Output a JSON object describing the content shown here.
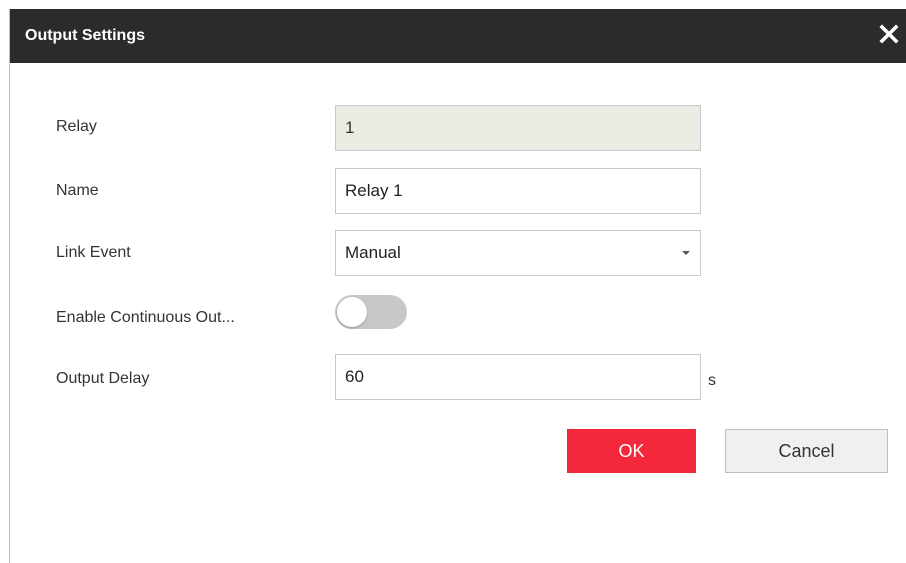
{
  "dialog": {
    "title": "Output Settings",
    "close_icon": "close-icon"
  },
  "form": {
    "relay": {
      "label": "Relay",
      "value": "1"
    },
    "name": {
      "label": "Name",
      "value": "Relay 1"
    },
    "link_event": {
      "label": "Link Event",
      "selected": "Manual",
      "icon": "chevron-down-icon"
    },
    "continuous_output": {
      "label": "Enable Continuous Out...",
      "enabled": false
    },
    "output_delay": {
      "label": "Output Delay",
      "value": "60",
      "unit": "s"
    }
  },
  "buttons": {
    "ok_label": "OK",
    "cancel_label": "Cancel"
  },
  "colors": {
    "titlebar": "#2b2b2b",
    "primary": "#f4283c",
    "toggle_off": "#c8c8c8",
    "readonly_bg": "#ebebe4"
  }
}
